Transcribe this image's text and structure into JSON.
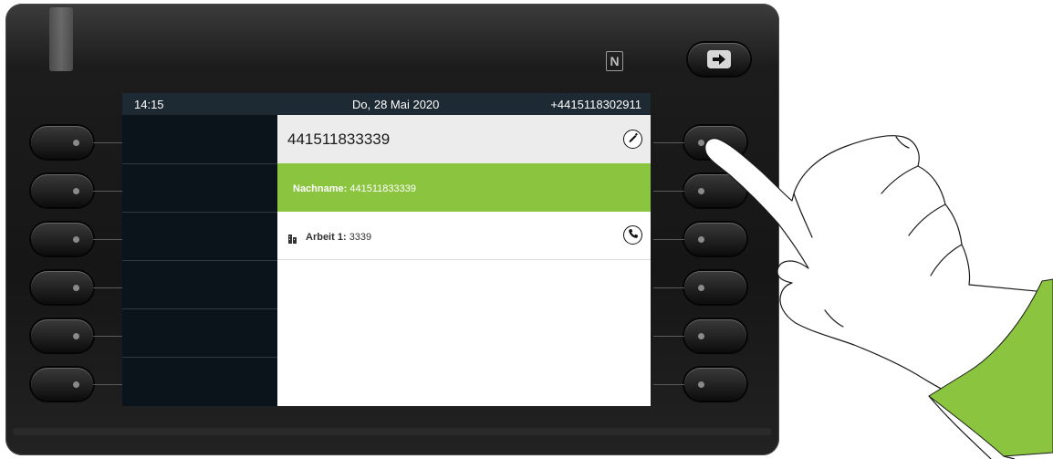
{
  "status_bar": {
    "time": "14:15",
    "date": "Do, 28 Mai 2020",
    "own_number": "+4415118302911"
  },
  "contact": {
    "number_title": "441511833339",
    "name_label": "Nachname:",
    "name_value": "441511833339",
    "work_label": "Arbeit 1:",
    "work_value": "3339"
  },
  "icons": {
    "nfc": "nfc-icon",
    "logout": "logout-icon",
    "edit": "pencil-icon",
    "call": "phone-handset-icon",
    "work": "building-icon"
  },
  "colors": {
    "accent_green": "#8bc53f",
    "statusbar_bg": "#1d2a33",
    "left_panel_bg": "#0b141a"
  }
}
